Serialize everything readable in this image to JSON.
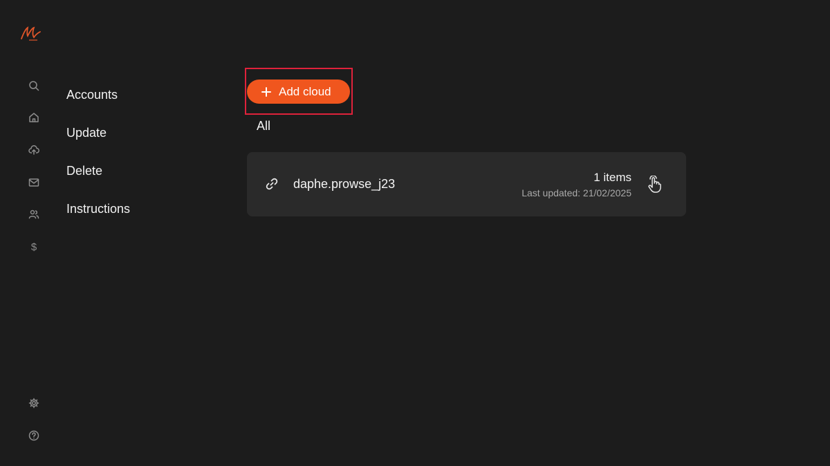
{
  "app": {
    "accent_color": "#f0561e",
    "background_color": "#1c1c1c",
    "highlight_color": "#e0223b"
  },
  "rail": {
    "icons": [
      "logo",
      "search-icon",
      "home-icon",
      "cloud-upload-icon",
      "mail-icon",
      "users-icon",
      "dollar-icon",
      "gear-icon",
      "help-icon"
    ],
    "dollar_glyph": "$"
  },
  "subnav": {
    "items": [
      {
        "label": "Accounts"
      },
      {
        "label": "Update"
      },
      {
        "label": "Delete"
      },
      {
        "label": "Instructions"
      }
    ]
  },
  "main": {
    "add_button_label": "Add cloud",
    "filter_label": "All",
    "clouds": [
      {
        "name": "daphe.prowse_j23",
        "items": "1 items",
        "last_updated": "Last updated: 21/02/2025"
      }
    ]
  }
}
